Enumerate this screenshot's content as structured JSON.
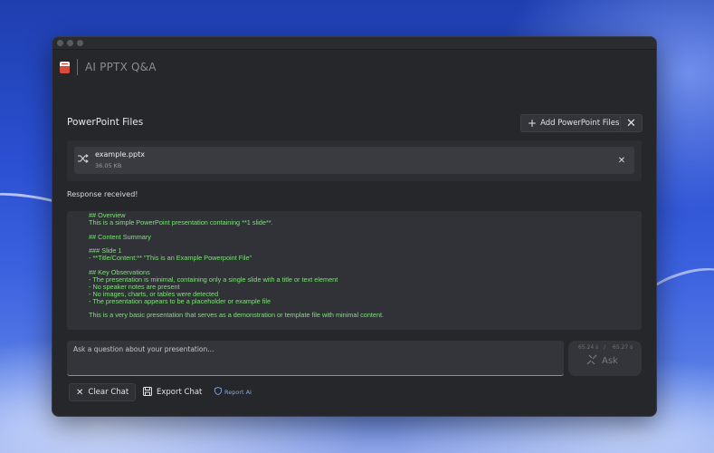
{
  "app": {
    "title": "AI PPTX Q&A",
    "icon": "presentation-file-icon"
  },
  "files_section": {
    "title": "PowerPoint Files",
    "add_label": "Add PowerPoint Files",
    "files": [
      {
        "name": "example.pptx",
        "size": "36.05 KB",
        "icon": "shuffle-icon"
      }
    ]
  },
  "status": "Response received!",
  "response_lines": [
    "## Overview",
    "This is a simple PowerPoint presentation containing **1 slide**.",
    "",
    "## Content Summary",
    "",
    "### Slide 1",
    "- **Title/Content:** \"This is an Example Powerpoint File\"",
    "",
    "## Key Observations",
    "- The presentation is minimal, containing only a single slide with a title or text element",
    "- No speaker notes are present",
    "- No images, charts, or tables were detected",
    "- The presentation appears to be a placeholder or example file",
    "",
    "This is a very basic presentation that serves as a demonstration or template file with minimal content."
  ],
  "ask": {
    "placeholder": "Ask a question about your presentation...",
    "timer_elapsed": "65.24 s",
    "timer_separator": "/",
    "timer_total": "65.27 s",
    "button_label": "Ask"
  },
  "footer": {
    "clear_label": "Clear Chat",
    "export_label": "Export Chat",
    "report_label": "Report AI"
  },
  "colors": {
    "window_bg": "#26272b",
    "response_text": "#7fe07a",
    "link": "#7fa9e6"
  }
}
